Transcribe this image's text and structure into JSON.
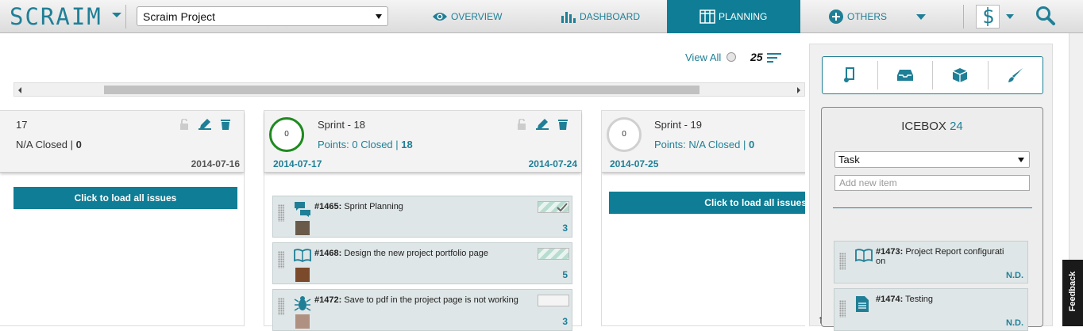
{
  "header": {
    "logo": "SCRAIM",
    "project": "Scraim Project",
    "nav": [
      {
        "label": "OVERVIEW",
        "icon": "eye-icon"
      },
      {
        "label": "DASHBOARD",
        "icon": "bar-chart-icon"
      },
      {
        "label": "PLANNING",
        "icon": "columns-icon",
        "active": true
      },
      {
        "label": "OTHERS",
        "icon": "plus-circle-icon"
      }
    ],
    "accent": "#0e7d95"
  },
  "toolbar": {
    "view_all": "View All",
    "count": "25"
  },
  "sprints": [
    {
      "title": "17",
      "points_label": "N/A Closed | ",
      "points_total": "0",
      "start": "",
      "end": "2014-07-16",
      "load_label": "Click to load all issues",
      "progress": "",
      "issues": []
    },
    {
      "title": "Sprint - 18",
      "points_label": "Points: 0 Closed | ",
      "points_total": "18",
      "start": "2014-07-17",
      "end": "2014-07-24",
      "progress": "0",
      "issues": [
        {
          "id": "#1465:",
          "text": " Sprint Planning",
          "points": "3",
          "icon": "chat-bubbles-icon"
        },
        {
          "id": "#1468:",
          "text": " Design the new project portfolio page",
          "points": "5",
          "icon": "book-icon"
        },
        {
          "id": "#1472:",
          "text": " Save to pdf in the project page is not working",
          "points": "3",
          "icon": "bug-icon"
        }
      ]
    },
    {
      "title": "Sprint - 19",
      "points_label": "Points: N/A Closed | ",
      "points_total": "0",
      "start": "2014-07-25",
      "end": "",
      "progress": "0",
      "load_label": "Click to load all issues",
      "issues": []
    }
  ],
  "icebox": {
    "title": "ICEBOX",
    "count": "24",
    "type_selected": "Task",
    "add_placeholder": "Add new item",
    "items": [
      {
        "id": "#1473:",
        "text": " Project Report configurati on",
        "points": "N.D.",
        "icon": "book-icon"
      },
      {
        "id": "#1474:",
        "text": " Testing",
        "points": "N.D.",
        "icon": "document-icon"
      }
    ],
    "tools": [
      "music-icon",
      "inbox-icon",
      "cube-icon",
      "brush-icon"
    ]
  },
  "feedback": "Feedback"
}
